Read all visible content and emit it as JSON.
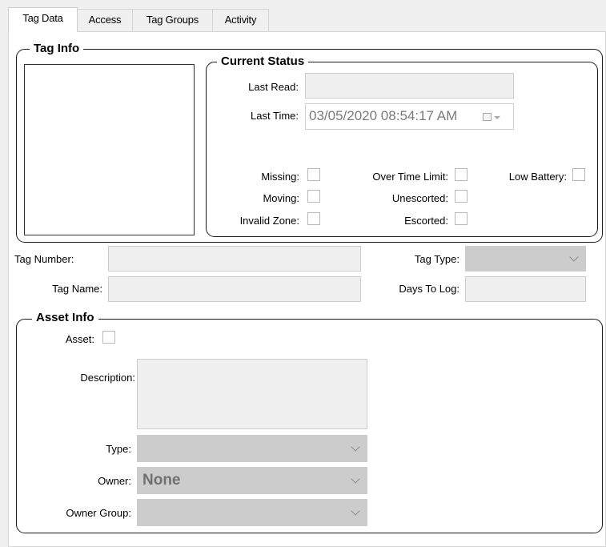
{
  "tabs": [
    {
      "label": "Tag Data",
      "active": true
    },
    {
      "label": "Access",
      "active": false
    },
    {
      "label": "Tag Groups",
      "active": false
    },
    {
      "label": "Activity",
      "active": false
    }
  ],
  "tag_info": {
    "title": "Tag Info",
    "current_status": {
      "title": "Current Status",
      "last_read_label": "Last Read:",
      "last_read_value": "",
      "last_time_label": "Last Time:",
      "last_time_value": "03/05/2020 08:54:17 AM",
      "flags": {
        "missing": {
          "label": "Missing:",
          "checked": false
        },
        "moving": {
          "label": "Moving:",
          "checked": false
        },
        "invalid_zone": {
          "label": "Invalid Zone:",
          "checked": false
        },
        "over_time_limit": {
          "label": "Over Time Limit:",
          "checked": false
        },
        "unescorted": {
          "label": "Unescorted:",
          "checked": false
        },
        "escorted": {
          "label": "Escorted:",
          "checked": false
        },
        "low_battery": {
          "label": "Low Battery:",
          "checked": false
        }
      }
    }
  },
  "tag_fields": {
    "tag_number_label": "Tag Number:",
    "tag_number_value": "",
    "tag_name_label": "Tag Name:",
    "tag_name_value": "",
    "tag_type_label": "Tag Type:",
    "tag_type_value": "",
    "days_to_log_label": "Days To Log:",
    "days_to_log_value": ""
  },
  "asset_info": {
    "title": "Asset Info",
    "asset_label": "Asset:",
    "asset_checked": false,
    "description_label": "Description:",
    "description_value": "",
    "type_label": "Type:",
    "type_value": "",
    "owner_label": "Owner:",
    "owner_value": "None",
    "owner_group_label": "Owner Group:",
    "owner_group_value": ""
  },
  "icons": {
    "calendar": "calendar-icon",
    "dropdown": "chevron-down-icon"
  }
}
